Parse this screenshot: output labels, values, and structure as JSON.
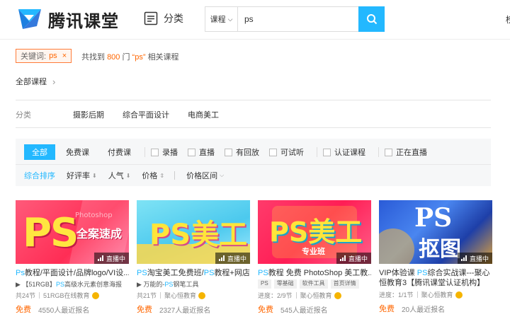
{
  "header": {
    "brand": "腾讯课堂",
    "category_label": "分类",
    "search_type": "课程",
    "search_value": "ps",
    "edge_text": "榜"
  },
  "keyword": {
    "label": "关键词:",
    "value": "ps",
    "close": "×"
  },
  "result": {
    "prefix": "共找到",
    "count": "800",
    "middle": "门",
    "query": "“ps”",
    "suffix": "相关课程"
  },
  "breadcrumb": {
    "label": "全部课程"
  },
  "categories": {
    "label": "分类",
    "items": [
      "摄影后期",
      "综合平面设计",
      "电商美工"
    ]
  },
  "filters": {
    "tabs": [
      "全部",
      "免费课",
      "付费课"
    ],
    "checks_a": [
      "录播",
      "直播",
      "有回放",
      "可试听"
    ],
    "checks_b": [
      "认证课程",
      "正在直播"
    ],
    "sorts": [
      "综合排序",
      "好评率",
      "人气",
      "价格",
      "价格区间"
    ]
  },
  "live_label": "直播中",
  "courses": [
    {
      "thumb_title": "PS",
      "thumb_sub": "全案速成",
      "thumb_bg": "Photoshop",
      "title_hl": "Ps",
      "title": "教程/平面设计/品牌logo/VI设...",
      "sub_pre": "▶ 【51RGB】",
      "sub_hl": "PS",
      "sub": "高级水元素创意海报",
      "lessons": "共24节",
      "org": "51RGB在线教育",
      "price": "免费",
      "signup": "4550人最近报名"
    },
    {
      "thumb_title": "PS美工",
      "title_hl": "PS",
      "title": "淘宝美工免费班/",
      "title_hl2": "PS",
      "title2": "教程+网店...",
      "sub_pre": "▶ 万能的-",
      "sub_hl": "PS",
      "sub": "钢笔工具",
      "lessons": "共21节",
      "org": "聚心恒教育",
      "price": "免费",
      "signup": "2327人最近报名"
    },
    {
      "thumb_title": "PS美工",
      "thumb_sub": "专业班",
      "title_hl": "PS",
      "title": "教程 免费 PhotoShop 美工教...",
      "tags": [
        "PS",
        "零基础",
        "软件工具",
        "首页详情"
      ],
      "lessons": "进度：2/9节",
      "org": "聚心恒教育",
      "price": "免费",
      "signup": "545人最近报名"
    },
    {
      "thumb_title": "PS",
      "thumb_sub": "抠图",
      "title_pre": "VIP体验课 ",
      "title_hl": "PS",
      "title": "综合实战课---聚心恒教育3【腾讯课堂认证机构】",
      "lessons": "进度：1/1节",
      "org": "聚心恒教育",
      "price": "免费",
      "signup": "20人最近报名"
    }
  ]
}
